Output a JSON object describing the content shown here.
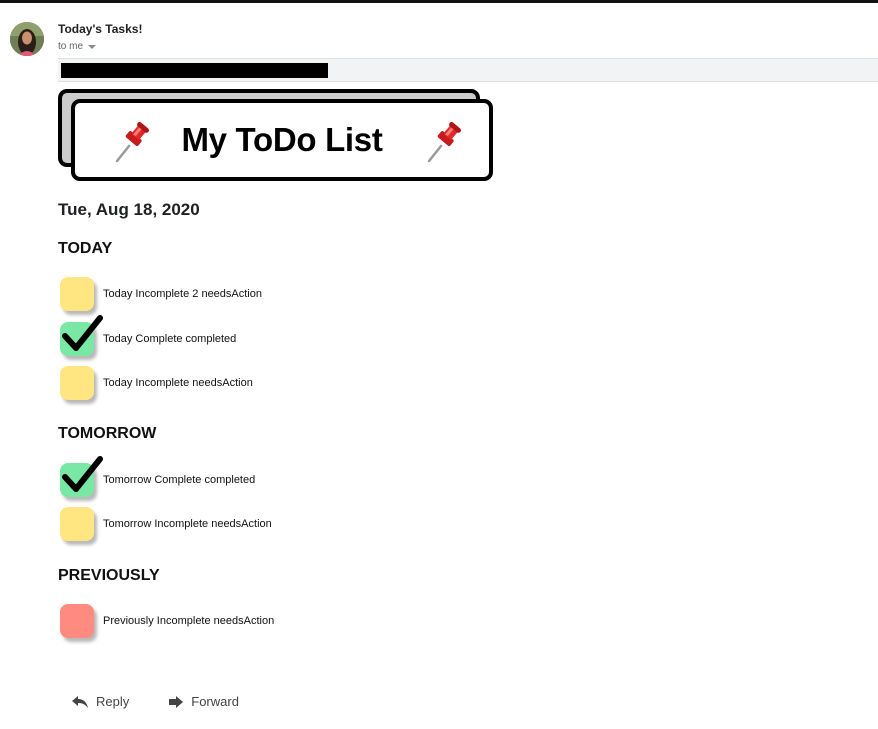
{
  "email": {
    "subject": "Today's Tasks!",
    "recipient": "to me"
  },
  "banner": {
    "title": "My ToDo List",
    "pin_icon": "pushpin-icon"
  },
  "date": "Tue, Aug 18, 2020",
  "sections": {
    "today": {
      "heading": "TODAY",
      "tasks": [
        {
          "label": "Today Incomplete 2 needsAction",
          "status": "needsAction"
        },
        {
          "label": "Today Complete completed",
          "status": "completed"
        },
        {
          "label": "Today Incomplete needsAction",
          "status": "needsAction"
        }
      ]
    },
    "tomorrow": {
      "heading": "TOMORROW",
      "tasks": [
        {
          "label": "Tomorrow Complete completed",
          "status": "completed"
        },
        {
          "label": "Tomorrow Incomplete needsAction",
          "status": "needsAction"
        }
      ]
    },
    "previously": {
      "heading": "PREVIOUSLY",
      "tasks": [
        {
          "label": "Previously Incomplete needsAction",
          "status": "overdue"
        }
      ]
    }
  },
  "actions": {
    "reply": "Reply",
    "forward": "Forward"
  },
  "colors": {
    "incomplete": "#ffe680",
    "complete": "#79e8a4",
    "overdue": "#ff8a80"
  }
}
